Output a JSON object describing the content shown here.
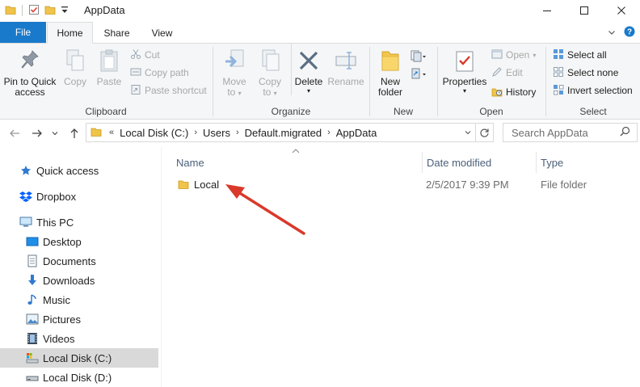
{
  "window": {
    "title": "AppData",
    "minimize_glyph": "—",
    "maximize_glyph": "☐",
    "close_glyph": "✕"
  },
  "ribbon_tabs": {
    "file": "File",
    "home": "Home",
    "share": "Share",
    "view": "View",
    "expand_glyph": "⌄",
    "help_glyph": "?"
  },
  "clipboard": {
    "label": "Clipboard",
    "pin_line1": "Pin to Quick",
    "pin_line2": "access",
    "copy": "Copy",
    "paste": "Paste",
    "cut": "Cut",
    "copy_path": "Copy path",
    "paste_shortcut": "Paste shortcut"
  },
  "organize": {
    "label": "Organize",
    "move_to_line1": "Move",
    "move_to_line2": "to",
    "copy_to_line1": "Copy",
    "copy_to_line2": "to",
    "delete": "Delete",
    "rename": "Rename"
  },
  "new_group": {
    "label": "New",
    "new_folder_line1": "New",
    "new_folder_line2": "folder"
  },
  "open_group": {
    "label": "Open",
    "properties": "Properties",
    "open": "Open",
    "edit": "Edit",
    "history": "History"
  },
  "select_group": {
    "label": "Select",
    "select_all": "Select all",
    "select_none": "Select none",
    "invert_selection": "Invert selection"
  },
  "address": {
    "overflow": "«",
    "crumbs": [
      "Local Disk (C:)",
      "Users",
      "Default.migrated",
      "AppData"
    ],
    "separator": "›",
    "dropdown": "⌄"
  },
  "search": {
    "placeholder": "Search AppData"
  },
  "nav_pane": {
    "items": [
      {
        "label": "Quick access",
        "icon": "star-icon"
      },
      {
        "label": "Dropbox",
        "icon": "dropbox-icon"
      },
      {
        "label": "This PC",
        "icon": "computer-icon"
      },
      {
        "label": "Desktop",
        "icon": "desktop-icon"
      },
      {
        "label": "Documents",
        "icon": "documents-icon"
      },
      {
        "label": "Downloads",
        "icon": "downloads-icon"
      },
      {
        "label": "Music",
        "icon": "music-icon"
      },
      {
        "label": "Pictures",
        "icon": "pictures-icon"
      },
      {
        "label": "Videos",
        "icon": "videos-icon"
      },
      {
        "label": "Local Disk (C:)",
        "icon": "drive-c-icon",
        "selected": true
      },
      {
        "label": "Local Disk (D:)",
        "icon": "drive-d-icon"
      }
    ]
  },
  "file_list": {
    "columns": {
      "name": "Name",
      "date_modified": "Date modified",
      "type": "Type"
    },
    "rows": [
      {
        "name": "Local",
        "date_modified": "2/5/2017 9:39 PM",
        "type": "File folder"
      }
    ]
  },
  "colors": {
    "accent": "#1979ca",
    "annotation_arrow": "#d9392b",
    "folder": "#f0c44a"
  }
}
